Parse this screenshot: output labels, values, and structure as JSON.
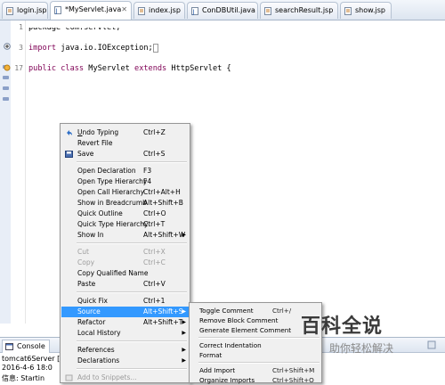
{
  "editor_tabs": [
    {
      "label": "login.jsp",
      "active": false
    },
    {
      "label": "*MyServlet.java",
      "active": true
    },
    {
      "label": "index.jsp",
      "active": false
    },
    {
      "label": "ConDBUtil.java",
      "active": false
    },
    {
      "label": "searchResult.jsp",
      "active": false
    },
    {
      "label": "show.jsp",
      "active": false
    }
  ],
  "code": {
    "line_numbers": [
      "1",
      "3",
      "17"
    ],
    "line1": "package com.servlet;",
    "line3_kw": "import",
    "line3_rest": " java.io.IOException;",
    "line17_kw": "public class",
    "line17_rest": " MyServlet ",
    "line17_kw2": "extends",
    "line17_rest2": " HttpServlet {"
  },
  "console": {
    "tab_label": "Console",
    "server_line": "tomcat6Server [Remo",
    "line1": "2016-4-6 18:0",
    "line2": "信息: Startin"
  },
  "context_menu": {
    "items": [
      {
        "label": "Undo Typing",
        "accel": "Ctrl+Z",
        "icon": "undo-icon"
      },
      {
        "label": "Revert File",
        "accel": ""
      },
      {
        "label": "Save",
        "accel": "Ctrl+S",
        "icon": "save-icon"
      },
      {
        "label": "Open Declaration",
        "accel": "F3"
      },
      {
        "label": "Open Type Hierarchy",
        "accel": "F4"
      },
      {
        "label": "Open Call Hierarchy",
        "accel": "Ctrl+Alt+H"
      },
      {
        "label": "Show in Breadcrumb",
        "accel": "Alt+Shift+B"
      },
      {
        "label": "Quick Outline",
        "accel": "Ctrl+O"
      },
      {
        "label": "Quick Type Hierarchy",
        "accel": "Ctrl+T"
      },
      {
        "label": "Show In",
        "accel": "Alt+Shift+W",
        "submenu": true
      },
      {
        "label": "Cut",
        "accel": "Ctrl+X",
        "disabled": true
      },
      {
        "label": "Copy",
        "accel": "Ctrl+C",
        "disabled": true
      },
      {
        "label": "Copy Qualified Name",
        "accel": ""
      },
      {
        "label": "Paste",
        "accel": "Ctrl+V"
      },
      {
        "label": "Quick Fix",
        "accel": "Ctrl+1"
      },
      {
        "label": "Source",
        "accel": "Alt+Shift+S",
        "submenu": true,
        "highlighted": true
      },
      {
        "label": "Refactor",
        "accel": "Alt+Shift+T",
        "submenu": true
      },
      {
        "label": "Local History",
        "accel": "",
        "submenu": true
      },
      {
        "label": "References",
        "accel": "",
        "submenu": true
      },
      {
        "label": "Declarations",
        "accel": "",
        "submenu": true
      },
      {
        "label": "Add to Snippets...",
        "accel": "",
        "disabled": true
      }
    ]
  },
  "source_submenu": {
    "items": [
      {
        "label": "Toggle Comment",
        "accel": "Ctrl+/"
      },
      {
        "label": "Remove Block Comment",
        "accel": ""
      },
      {
        "label": "Generate Element Comment",
        "accel": ""
      },
      {
        "label": "Correct Indentation",
        "accel": ""
      },
      {
        "label": "Format",
        "accel": ""
      },
      {
        "label": "Add Import",
        "accel": "Ctrl+Shift+M"
      },
      {
        "label": "Organize Imports",
        "accel": "Ctrl+Shift+O"
      }
    ]
  },
  "watermark": {
    "logo": "百科全说",
    "sub": "助你轻松解决"
  },
  "colors": {
    "highlight": "#3399ff",
    "keyword": "#7f0055",
    "menu_bg": "#f0f0f0"
  }
}
